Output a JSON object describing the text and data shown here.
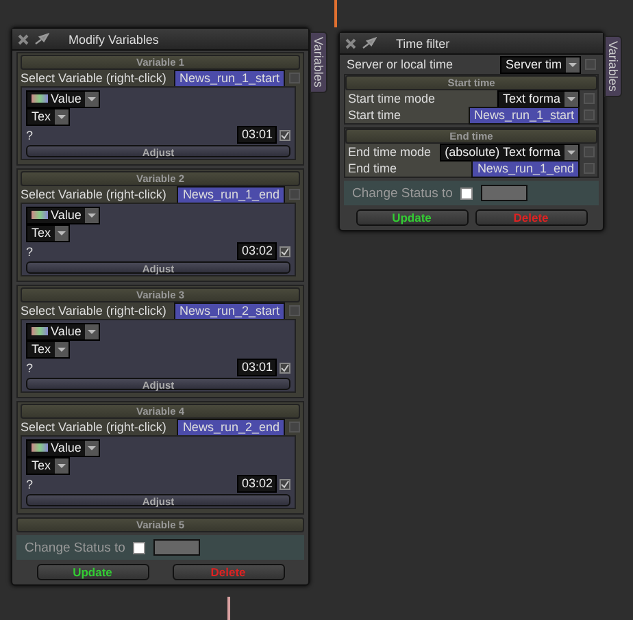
{
  "modify_panel": {
    "title": "Modify Variables",
    "side_tab": "Variables",
    "variables": [
      {
        "header": "Variable 1",
        "select_label": "Select Variable (right-click)",
        "variable": "News_run_1_start",
        "var_checked": false,
        "type": "Value",
        "format": "Tex",
        "help": "?",
        "time": "03:01",
        "checked": true,
        "button": "Adjust"
      },
      {
        "header": "Variable 2",
        "select_label": "Select Variable (right-click)",
        "variable": "News_run_1_end",
        "var_checked": false,
        "type": "Value",
        "format": "Tex",
        "help": "?",
        "time": "03:02",
        "checked": true,
        "button": "Adjust"
      },
      {
        "header": "Variable 3",
        "select_label": "Select Variable (right-click)",
        "variable": "News_run_2_start",
        "var_checked": false,
        "type": "Value",
        "format": "Tex",
        "help": "?",
        "time": "03:01",
        "checked": true,
        "button": "Adjust"
      },
      {
        "header": "Variable 4",
        "select_label": "Select Variable (right-click)",
        "variable": "News_run_2_end",
        "var_checked": false,
        "type": "Value",
        "format": "Tex",
        "help": "?",
        "time": "03:02",
        "checked": true,
        "button": "Adjust"
      }
    ],
    "last_header": "Variable 5",
    "status_label": "Change Status to",
    "status_checked": false,
    "buttons": [
      {
        "label": "Update",
        "kind": "update"
      },
      {
        "label": "Delete",
        "kind": "delete"
      }
    ]
  },
  "time_filter": {
    "title": "Time filter",
    "side_tab": "Variables",
    "rows": [
      {
        "kind": "dropdown",
        "label": "Server or local time",
        "value": "Server tim",
        "checked": false
      }
    ],
    "sections": [
      {
        "header": "Start time",
        "rows": [
          {
            "kind": "dropdown",
            "label": "Start time mode",
            "value": "Text forma",
            "checked": false
          },
          {
            "kind": "variable",
            "label": "Start time",
            "value": "News_run_1_start",
            "checked": false
          }
        ]
      },
      {
        "header": "End time",
        "rows": [
          {
            "kind": "dropdown",
            "label": "End time mode",
            "value": "(absolute) Text forma",
            "checked": false
          },
          {
            "kind": "variable",
            "label": "End time",
            "value": "News_run_1_end",
            "checked": false
          }
        ]
      }
    ],
    "status_label": "Change Status to",
    "status_checked": false,
    "buttons": [
      {
        "label": "Update",
        "kind": "update"
      },
      {
        "label": "Delete",
        "kind": "delete"
      }
    ]
  }
}
